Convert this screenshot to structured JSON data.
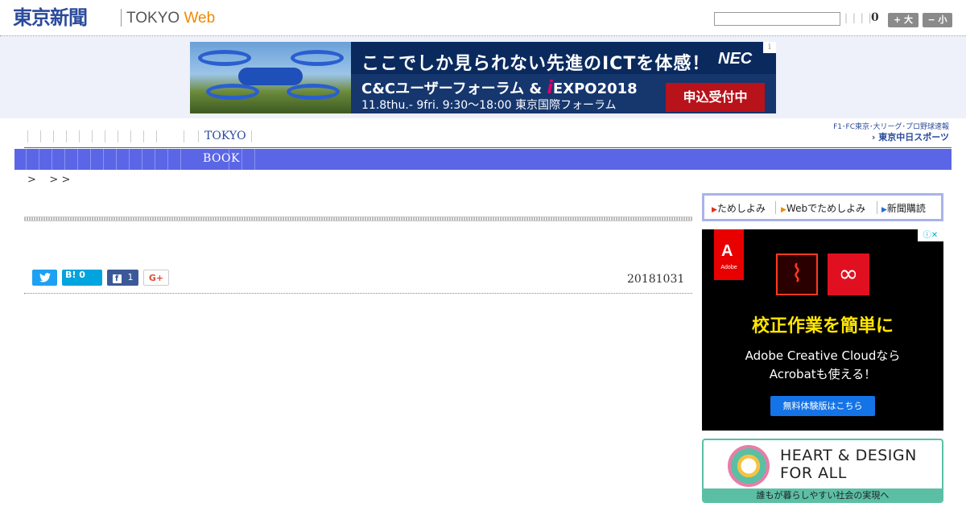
{
  "header": {
    "logo_jp": "東京新聞",
    "logo_tokyo": "TOKYO",
    "logo_web": "Web",
    "search_value": "",
    "bars": "| | | |",
    "count": "0",
    "size_large": "+ 大",
    "size_small": "− 小"
  },
  "banner": {
    "headline": "ここでしか見られない先進のICTを体感！",
    "brand": "NEC",
    "info": "i",
    "event_prefix": "C&Cユーザーフォーラム & ",
    "event_i": "i",
    "event_suffix": "EXPO2018",
    "date": "11.8thu.- 9fri. 9:30〜18:00  東京国際フォーラム",
    "cta": "申込受付中"
  },
  "topnav": {
    "tokyo_label": "TOKYO",
    "chunichi_small": "F1･FC東京･大リーグ･プロ野球速報",
    "chunichi_big": "› 東京中日スポーツ"
  },
  "bluebar": {
    "book_label": "BOOK"
  },
  "breadcrumb": {
    "text": ">    > >"
  },
  "article": {
    "share_twitter": "",
    "share_hatena": "B! 0",
    "share_facebook": "1",
    "share_gplus": "G+",
    "date": "20181031"
  },
  "sidebar": {
    "subscribe": [
      {
        "arrow": "▶",
        "label": "ためしよみ"
      },
      {
        "arrow": "▶",
        "label": "Webでためしよみ"
      },
      {
        "arrow": "▶",
        "label": "新聞購読"
      }
    ],
    "adobe_ad": {
      "logo": "Adobe",
      "headline": "校正作業を簡単に",
      "line1": "Adobe Creative Cloudなら",
      "line2": "Acrobatも使える！",
      "cta": "無料体験版はこちら",
      "adchoice": "ⓘ✕"
    },
    "hd_ad": {
      "title_line1": "HEART & DESIGN",
      "title_line2": "FOR ALL",
      "footer": "誰もが暮らしやすい社会の実現へ"
    }
  },
  "colors": {
    "brand_blue": "#2a4a9b",
    "nav_bar": "#5b66e6",
    "banner_bg": "#eef0fa",
    "web_orange": "#f08a00"
  }
}
